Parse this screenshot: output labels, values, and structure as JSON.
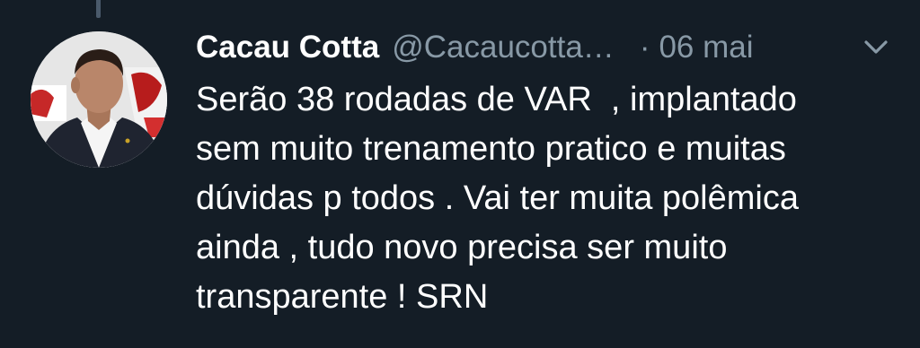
{
  "tweet": {
    "author": {
      "display_name": "Cacau Cotta",
      "handle": "@Cacaucotta…",
      "avatar_icon": "profile-photo"
    },
    "separator": "·",
    "date": "06 mai",
    "menu_icon": "chevron-down-icon",
    "text_lines": [
      "Serão 38 rodadas de VAR  , implantado",
      "sem muito trenamento pratico e muitas",
      "dúvidas p todos . Vai ter muita polêmica",
      "ainda , tudo novo precisa ser muito",
      "transparente ! SRN"
    ]
  },
  "colors": {
    "background": "#141d26",
    "primary_text": "#ffffff",
    "secondary_text": "#8899a6",
    "thread_line": "#4a5a6b"
  }
}
